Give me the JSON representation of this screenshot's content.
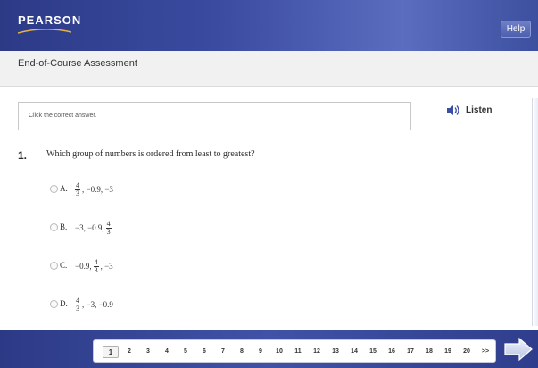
{
  "header": {
    "logo_text": "PEARSON",
    "help_label": "Help",
    "bg_colors": [
      "#2c3a86",
      "#5a6dbe"
    ]
  },
  "subheader": {
    "title": "End-of-Course Assessment"
  },
  "instruction": {
    "text": "Click the correct answer."
  },
  "listen": {
    "label": "Listen",
    "icon": "speaker-icon"
  },
  "question": {
    "number": "1.",
    "text": "Which group of numbers is ordered from least to greatest?",
    "options": [
      {
        "letter": "A.",
        "parts": [
          {
            "num": "4",
            "den": "3"
          },
          ", −0.9, −3"
        ]
      },
      {
        "letter": "B.",
        "parts": [
          "−3, −0.9, ",
          {
            "num": "4",
            "den": "3"
          }
        ]
      },
      {
        "letter": "C.",
        "parts": [
          "−0.9, ",
          {
            "num": "4",
            "den": "3"
          },
          ", −3"
        ]
      },
      {
        "letter": "D.",
        "parts": [
          {
            "num": "4",
            "den": "3"
          },
          ", −3, −0.9"
        ]
      }
    ]
  },
  "pager": {
    "current": "1",
    "pages": [
      "1",
      "2",
      "3",
      "4",
      "5",
      "6",
      "7",
      "8",
      "9",
      "10",
      "11",
      "12",
      "13",
      "14",
      "15",
      "16",
      "17",
      "18",
      "19",
      "20"
    ],
    "more_label": ">>"
  },
  "next_button": {
    "icon": "right-arrow-icon"
  }
}
